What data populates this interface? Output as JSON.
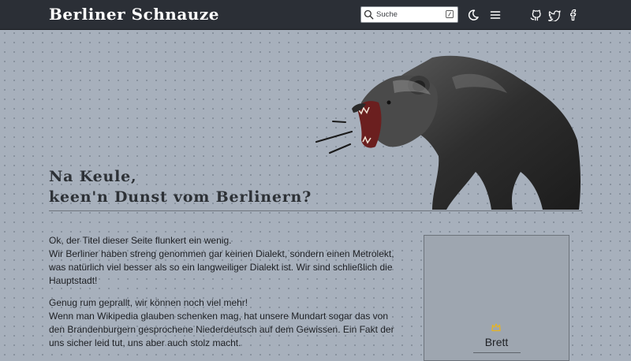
{
  "header": {
    "brand": "Berliner Schnauze",
    "search_placeholder": "Suche",
    "icons": [
      "search-icon",
      "keyboard-shortcut-icon",
      "dark-mode-moon-icon",
      "menu-hamburger-icon",
      "github-icon",
      "twitter-icon",
      "facebook-icon"
    ]
  },
  "hero": {
    "title_line1": "Na Keule,",
    "title_line2": "keen'n Dunst vom Berlinern?",
    "image": "roaring-bear-illustration"
  },
  "main": {
    "p1": "Ok, der Titel dieser Seite flunkert ein wenig.",
    "p2": "Wir Berliner haben streng genommen gar keinen Dialekt, sondern einen Metrolekt, was natürlich viel besser als so ein langweiliger Dialekt ist. Wir sind schließlich die Hauptstadt!",
    "p3": "Genug rum geprallt, wir können noch viel mehr!",
    "p4": "Wenn man Wikipedia glauben schenken mag, hat unsere Mundart sogar das von den Brandenburgern gesprochene Niederdeutsch auf dem Gewissen. Ein Fakt der uns sicher leid tut, uns aber auch stolz macht."
  },
  "aside": {
    "label": "Brett",
    "icon": "crown-icon",
    "accent": "#e6b422"
  },
  "colors": {
    "topbar": "#2b2f36",
    "page_bg": "#a7b0bc"
  }
}
